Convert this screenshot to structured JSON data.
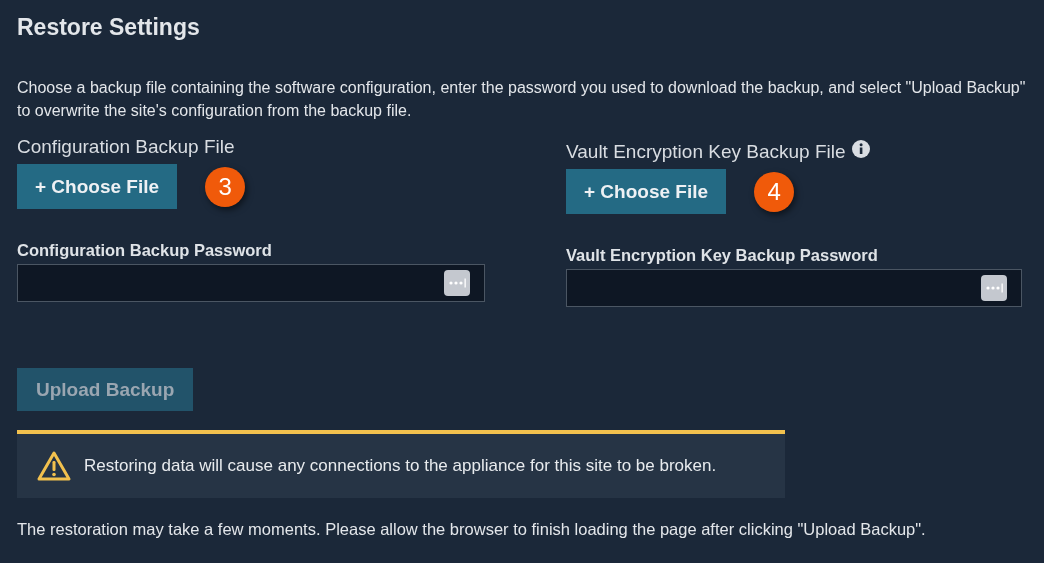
{
  "title": "Restore Settings",
  "intro": "Choose a backup file containing the software configuration, enter the password you used to download the backup, and select \"Upload Backup\" to overwrite the site's configuration from the backup file.",
  "columns": [
    {
      "file_label": "Configuration Backup File",
      "info": false,
      "choose_button": "+ Choose File",
      "callout": "3",
      "password_label": "Configuration Backup Password"
    },
    {
      "file_label": "Vault Encryption Key Backup File",
      "info": true,
      "choose_button": "+ Choose File",
      "callout": "4",
      "password_label": "Vault Encryption Key Backup Password"
    }
  ],
  "upload_button": {
    "label": "Upload Backup",
    "disabled": true
  },
  "warning": "Restoring data will cause any connections to the appliance for this site to be broken.",
  "footer": "The restoration may take a few moments. Please allow the browser to finish loading the page after clicking \"Upload Backup\"."
}
